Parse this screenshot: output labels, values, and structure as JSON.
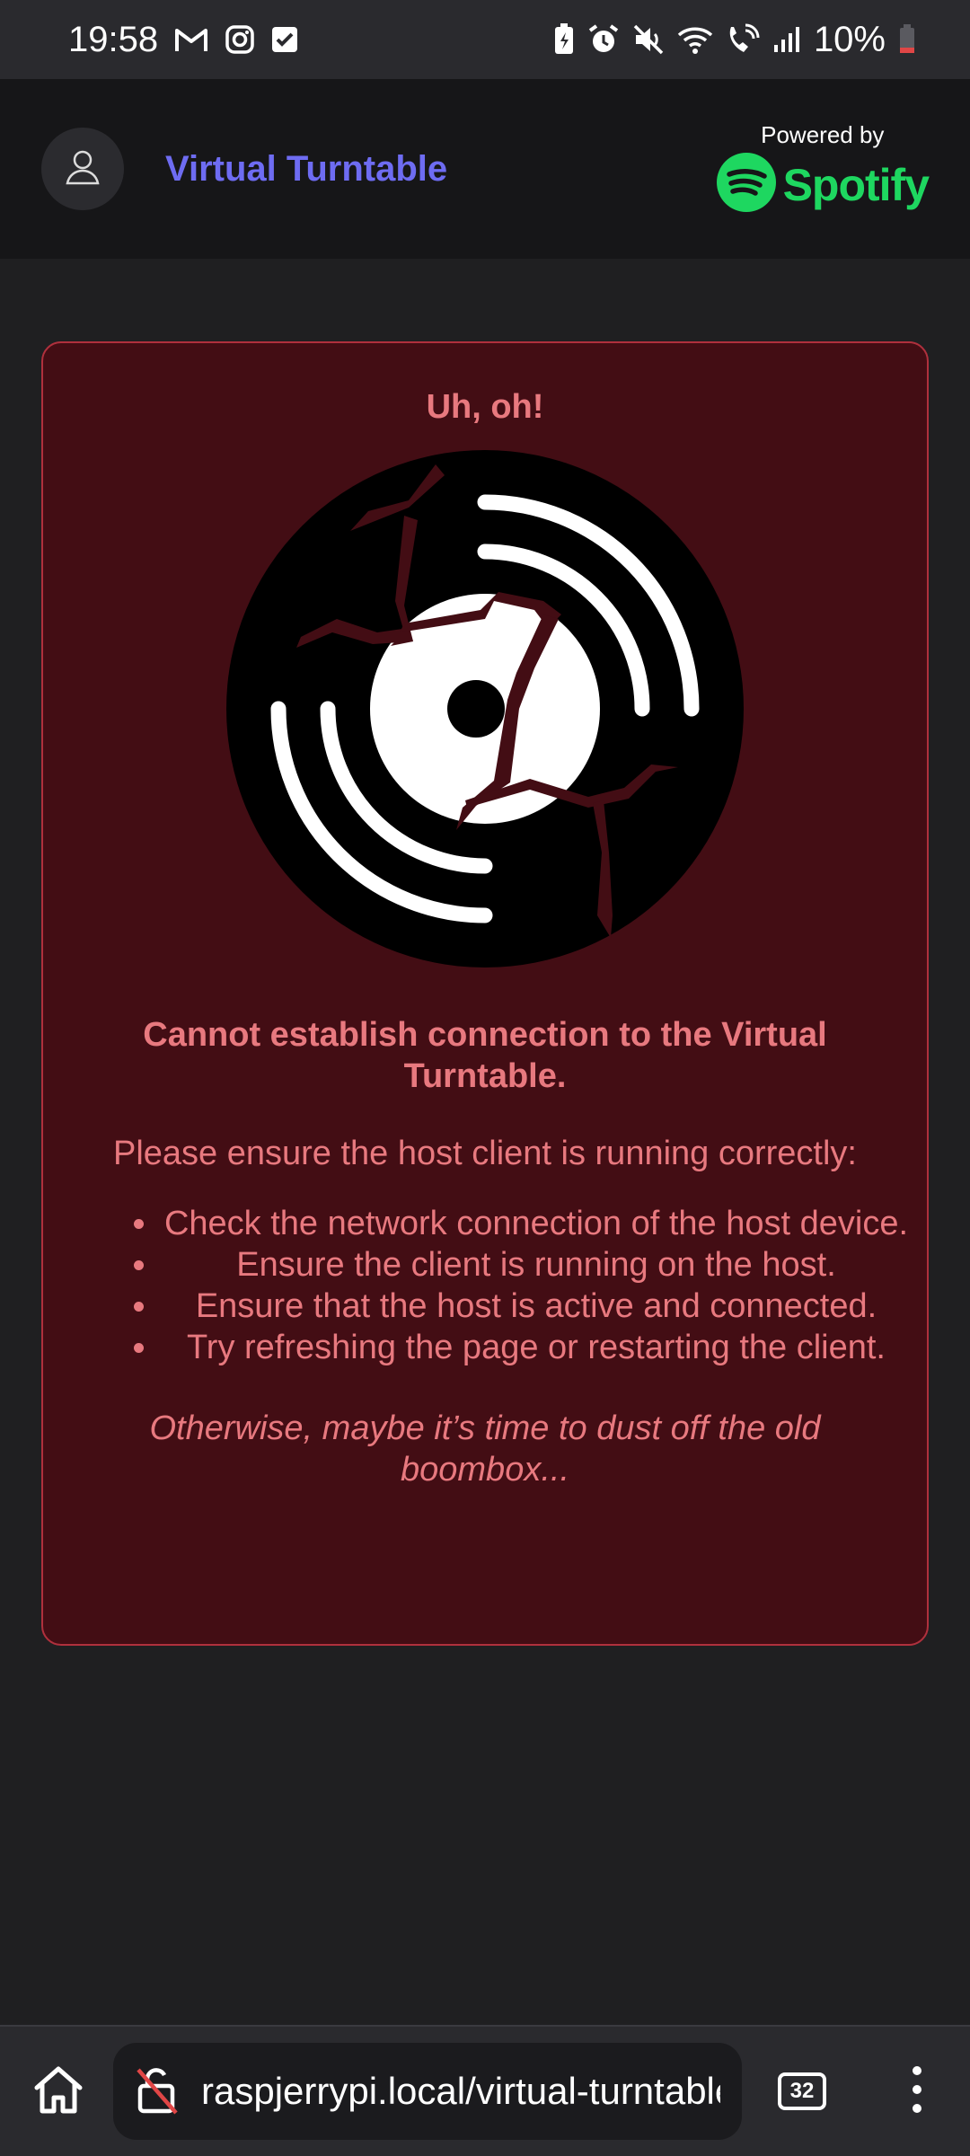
{
  "status_bar": {
    "time": "19:58",
    "battery_percent": "10%",
    "notification_icons": [
      "gmail-icon",
      "instagram-icon",
      "tasks-check-icon"
    ],
    "system_icons": [
      "battery-saver-icon",
      "alarm-icon",
      "mute-icon",
      "wifi-icon",
      "wifi-calling-icon",
      "signal-icon",
      "battery-low-icon"
    ]
  },
  "header": {
    "title": "Virtual Turntable",
    "powered_by_label": "Powered by",
    "brand_name": "Spotify",
    "title_color": "#6e6cf2",
    "brand_color": "#1ed760"
  },
  "error": {
    "heading": "Uh, oh!",
    "title": "Cannot establish connection to the Virtual Turntable.",
    "intro": "Please ensure the host client is running correctly:",
    "tips": [
      "Check the network connection of the host device.",
      "Ensure the client is running on the host.",
      "Ensure that the host is active and connected.",
      "Try refreshing the page or restarting the client."
    ],
    "footer": "Otherwise, maybe it’s time to dust off the old boombox...",
    "text_color": "#e8797f",
    "background_color": "#430d14"
  },
  "browser": {
    "url": "raspjerrypi.local/virtual-turntable",
    "tab_count": "32"
  }
}
